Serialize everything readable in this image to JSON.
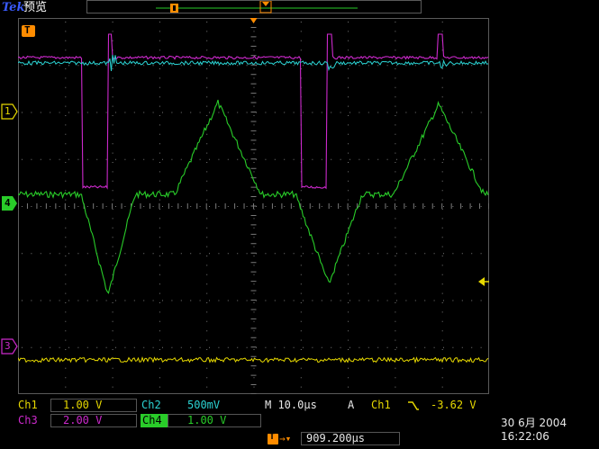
{
  "header": {
    "brand": "Tek",
    "status": "预览"
  },
  "markers": {
    "trigger_position": "T",
    "ch1": "1",
    "ch4": "4",
    "ch3": "3"
  },
  "ch1": {
    "label": "Ch1",
    "scale": "1.00 V"
  },
  "ch2": {
    "label": "Ch2",
    "scale": "500mV"
  },
  "ch3": {
    "label": "Ch3",
    "scale": "2.00 V"
  },
  "ch4": {
    "label": "Ch4",
    "scale": "1.00 V"
  },
  "timebase": {
    "label": "M 10.0µs"
  },
  "trigger": {
    "mode": "A",
    "source": "Ch1",
    "slope_symbol": "⌐",
    "level": "-3.62 V"
  },
  "position": {
    "value": "909.200µs"
  },
  "datetime": {
    "date": "30 6月  2004",
    "time": "16:22:06"
  },
  "colors": {
    "ch1": "#e6d800",
    "ch2": "#2bd3d3",
    "ch3": "#cc29cc",
    "ch4": "#29cc29",
    "trigger": "#ff8c00",
    "grid": "#7a7a7a"
  }
}
